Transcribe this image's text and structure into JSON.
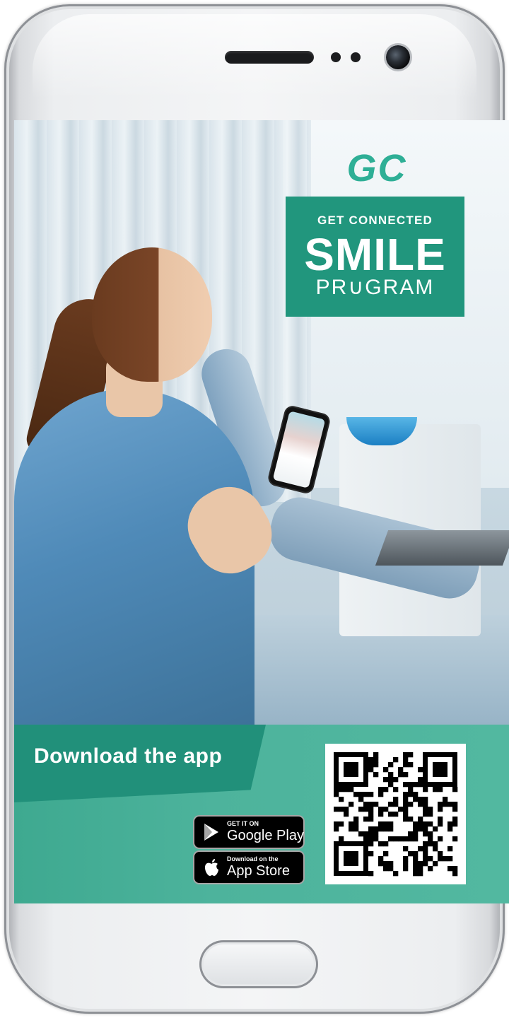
{
  "brand": {
    "logo": "GC",
    "program_tagline": "GET CONNECTED",
    "program_title": "SMILE",
    "program_subtitle": "PR∪GRAM",
    "accent_color": "#21967d",
    "logo_color": "#2eaf96"
  },
  "download": {
    "label": "Download the app"
  },
  "stores": {
    "google_play": {
      "small": "GET IT ON",
      "big": "Google Play",
      "icon": "play-store-icon"
    },
    "app_store": {
      "small": "Download on the",
      "big": "App Store",
      "icon": "apple-icon"
    }
  },
  "qr": {
    "icon": "qr-code"
  }
}
